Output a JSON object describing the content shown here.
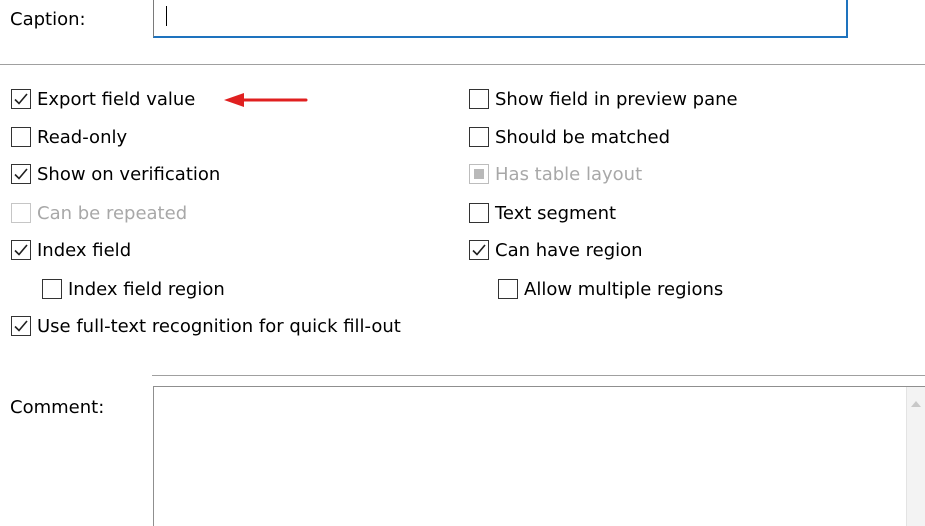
{
  "caption": {
    "label": "Caption:",
    "value": ""
  },
  "options_left": [
    {
      "label": "Export field value",
      "checked": true,
      "disabled": false
    },
    {
      "label": "Read-only",
      "checked": false,
      "disabled": false
    },
    {
      "label": "Show on verification",
      "checked": true,
      "disabled": false
    },
    {
      "label": "Can be repeated",
      "checked": false,
      "disabled": true
    },
    {
      "label": "Index field",
      "checked": true,
      "disabled": false
    },
    {
      "label": "Index field region",
      "checked": false,
      "disabled": false
    },
    {
      "label": "Use full-text recognition for quick fill-out",
      "checked": true,
      "disabled": false
    }
  ],
  "options_right": [
    {
      "label": "Show field in preview pane",
      "checked": false,
      "disabled": false
    },
    {
      "label": "Should be matched",
      "checked": false,
      "disabled": false
    },
    {
      "label": "Has table layout",
      "checked": "indeterminate",
      "disabled": true
    },
    {
      "label": "Text segment",
      "checked": false,
      "disabled": false
    },
    {
      "label": "Can have region",
      "checked": true,
      "disabled": false
    },
    {
      "label": "Allow multiple regions",
      "checked": false,
      "disabled": false
    }
  ],
  "comment": {
    "label": "Comment:",
    "value": ""
  },
  "colors": {
    "arrow": "#e02020",
    "checkmark": "#1f1f1f",
    "input_focus_border": "#1e73be",
    "disabled_text": "#a8a8a8"
  },
  "icons": {
    "annotation_arrow": "left-arrow-icon",
    "check": "checkmark-icon",
    "scroll_up": "scroll-up-arrow-icon"
  }
}
